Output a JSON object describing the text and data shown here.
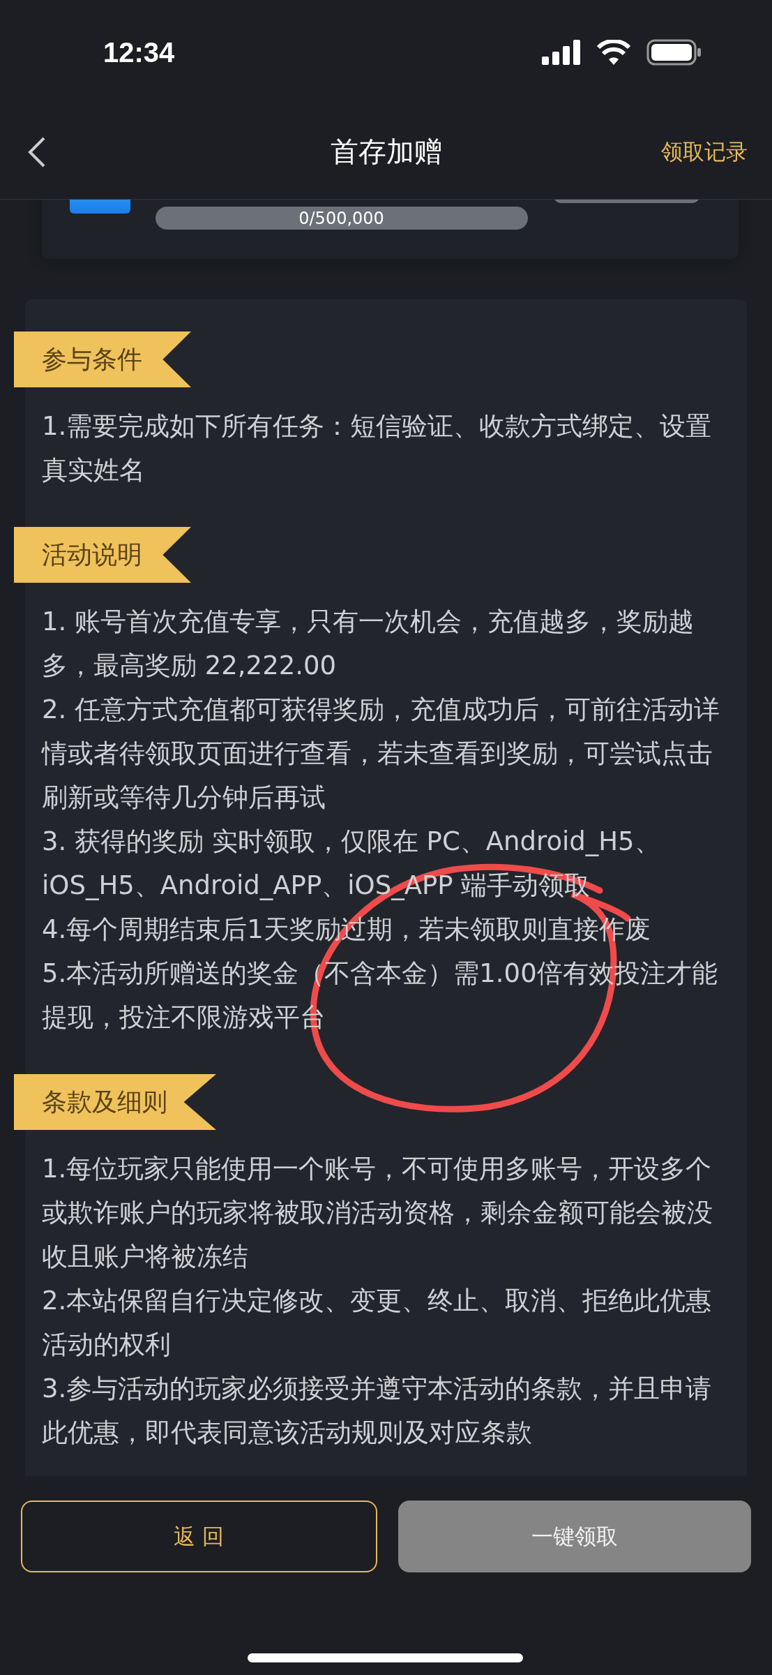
{
  "status_bar": {
    "time": "12:34"
  },
  "nav": {
    "title": "首存加赠",
    "action": "领取记录"
  },
  "reward_card": {
    "progress": {
      "level": 0,
      "reading": "0/500,000"
    }
  },
  "sections": [
    {
      "title": "参与条件",
      "items": [
        "1.需要完成如下所有任务：短信验证、收款方式绑定、设置真实姓名"
      ]
    },
    {
      "title": "活动说明",
      "items": [
        "1. 账号首次充值专享，只有一次机会，充值越多，奖励越多，最高奖励 22,222.00",
        "2. 任意方式充值都可获得奖励，充值成功后，可前往活动详情或者待领取页面进行查看，若未查看到奖励，可尝试点击刷新或等待几分钟后再试",
        "3. 获得的奖励 实时领取，仅限在 PC、Android_H5、iOS_H5、Android_APP、iOS_APP 端手动领取",
        "4.每个周期结束后1天奖励过期，若未领取则直接作废",
        "5.本活动所赠送的奖金（不含本金）需1.00倍有效投注才能提现，投注不限游戏平台"
      ]
    },
    {
      "title": "条款及细则",
      "items": [
        "1.每位玩家只能使用一个账号，不可使用多账号，开设多个或欺诈账户的玩家将被取消活动资格，剩余金额可能会被没收且账户将被冻结",
        "2.本站保留自行决定修改、变更、终止、取消、拒绝此优惠活动的权利",
        "3.参与活动的玩家必须接受并遵守本活动的条款，并且申请此优惠，即代表同意该活动规则及对应条款"
      ]
    }
  ],
  "buttons": [
    {
      "label": "返 回",
      "kind": "outline"
    },
    {
      "label": "一键领取",
      "kind": "filled",
      "disabled": true
    }
  ]
}
